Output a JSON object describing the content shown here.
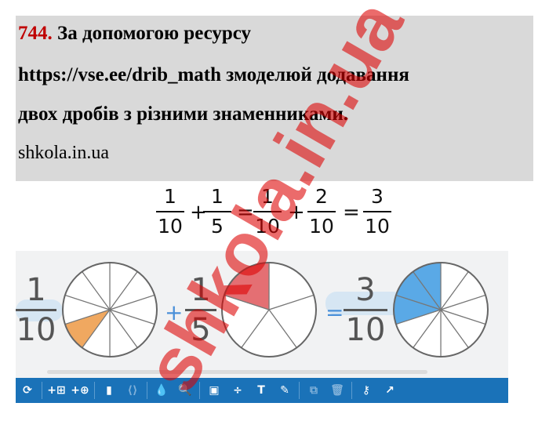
{
  "task": {
    "number": "744.",
    "title": "За допомогою ресурсу",
    "line2": "https://vse.ee/drib_math змоделюй додавання",
    "line3": "двох дробів з різними знаменниками.",
    "source": "shkola.in.ua"
  },
  "equation": {
    "fractions": [
      {
        "num": "1",
        "den": "10"
      },
      {
        "num": "1",
        "den": "5"
      },
      {
        "num": "1",
        "den": "10"
      },
      {
        "num": "2",
        "den": "10"
      },
      {
        "num": "3",
        "den": "10"
      }
    ],
    "ops": [
      "+",
      "=",
      "+",
      "="
    ]
  },
  "widget": {
    "fractions": [
      {
        "num": "1",
        "den": "10"
      },
      {
        "num": "1",
        "den": "5"
      },
      {
        "num": "3",
        "den": "10"
      }
    ],
    "ops": [
      "+",
      "="
    ],
    "pies": [
      {
        "slices": 10,
        "filled": 1,
        "color": "#f0a860"
      },
      {
        "slices": 5,
        "filled": 1,
        "color": "#e46f73"
      },
      {
        "slices": 10,
        "filled": 3,
        "color": "#5aa9e6"
      }
    ]
  },
  "toolbar": {
    "background": "#1a72b8",
    "buttons": [
      {
        "name": "refresh-icon",
        "glyph": "⟳",
        "dim": false
      },
      {
        "name": "add-grid-icon",
        "glyph": "+⊞",
        "dim": false
      },
      {
        "name": "add-circle-icon",
        "glyph": "+⊕",
        "dim": false
      },
      {
        "name": "color-block-icon",
        "glyph": "▮",
        "dim": false
      },
      {
        "name": "fraction-bracket-icon",
        "glyph": "⟨⟩",
        "dim": true
      },
      {
        "name": "fill-drop-icon",
        "glyph": "💧",
        "dim": false
      },
      {
        "name": "zoom-icon",
        "glyph": "🔍",
        "dim": false
      },
      {
        "name": "window-icon",
        "glyph": "▣",
        "dim": false
      },
      {
        "name": "operations-icon",
        "glyph": "÷",
        "dim": false
      },
      {
        "name": "text-icon",
        "glyph": "T",
        "dim": false
      },
      {
        "name": "pen-icon",
        "glyph": "✎",
        "dim": false
      },
      {
        "name": "copy-icon",
        "glyph": "⧉",
        "dim": true
      },
      {
        "name": "trash-icon",
        "glyph": "🗑",
        "dim": true
      },
      {
        "name": "key-icon",
        "glyph": "⚷",
        "dim": false
      },
      {
        "name": "share-icon",
        "glyph": "↗",
        "dim": false
      }
    ]
  },
  "watermark": "shkola.in.ua"
}
